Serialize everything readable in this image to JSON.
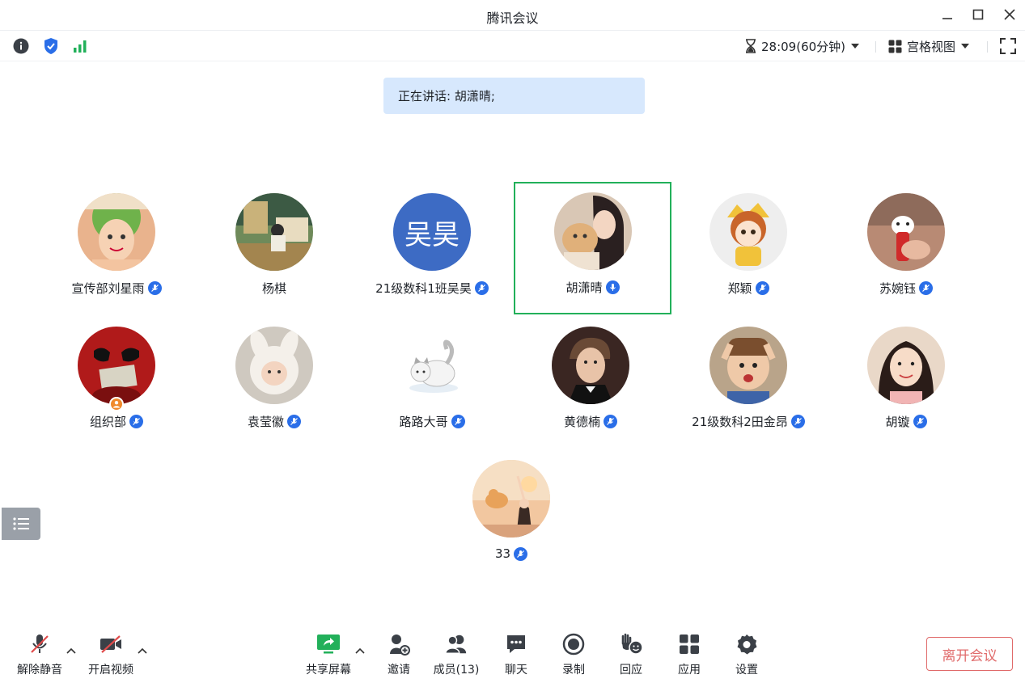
{
  "window": {
    "title": "腾讯会议"
  },
  "top_bar": {
    "timer": "28:09(60分钟)",
    "view_mode": "宫格视图"
  },
  "speaking_banner": "正在讲话: 胡潇晴;",
  "participants": [
    {
      "name": "宣传部刘星雨",
      "mic": "muted"
    },
    {
      "name": "杨棋",
      "mic": "none"
    },
    {
      "name": "21级数科1班吴昊",
      "mic": "muted",
      "avatar_text": "吴昊",
      "avatar_color": "#3d6bc4"
    },
    {
      "name": "胡潇晴",
      "mic": "speaking",
      "active": true
    },
    {
      "name": "郑颖",
      "mic": "muted"
    },
    {
      "name": "苏婉钰",
      "mic": "muted"
    },
    {
      "name": "组织部",
      "mic": "muted",
      "host": true
    },
    {
      "name": "袁莹徽",
      "mic": "muted"
    },
    {
      "name": "路路大哥",
      "mic": "muted"
    },
    {
      "name": "黄德楠",
      "mic": "muted"
    },
    {
      "name": "21级数科2田金昂",
      "mic": "muted"
    },
    {
      "name": "胡镟",
      "mic": "muted"
    },
    {
      "name": "33",
      "mic": "muted"
    }
  ],
  "bottom_bar": {
    "unmute": "解除静音",
    "start_video": "开启视频",
    "share_screen": "共享屏幕",
    "invite": "邀请",
    "members": "成员(13)",
    "chat": "聊天",
    "record": "录制",
    "reactions": "回应",
    "apps": "应用",
    "settings": "设置",
    "leave": "离开会议"
  },
  "colors": {
    "accent_green": "#22b05a",
    "mic_blue": "#2a6ee8",
    "banner_bg": "#d7e8fd",
    "leave_red": "#e06a6a"
  }
}
